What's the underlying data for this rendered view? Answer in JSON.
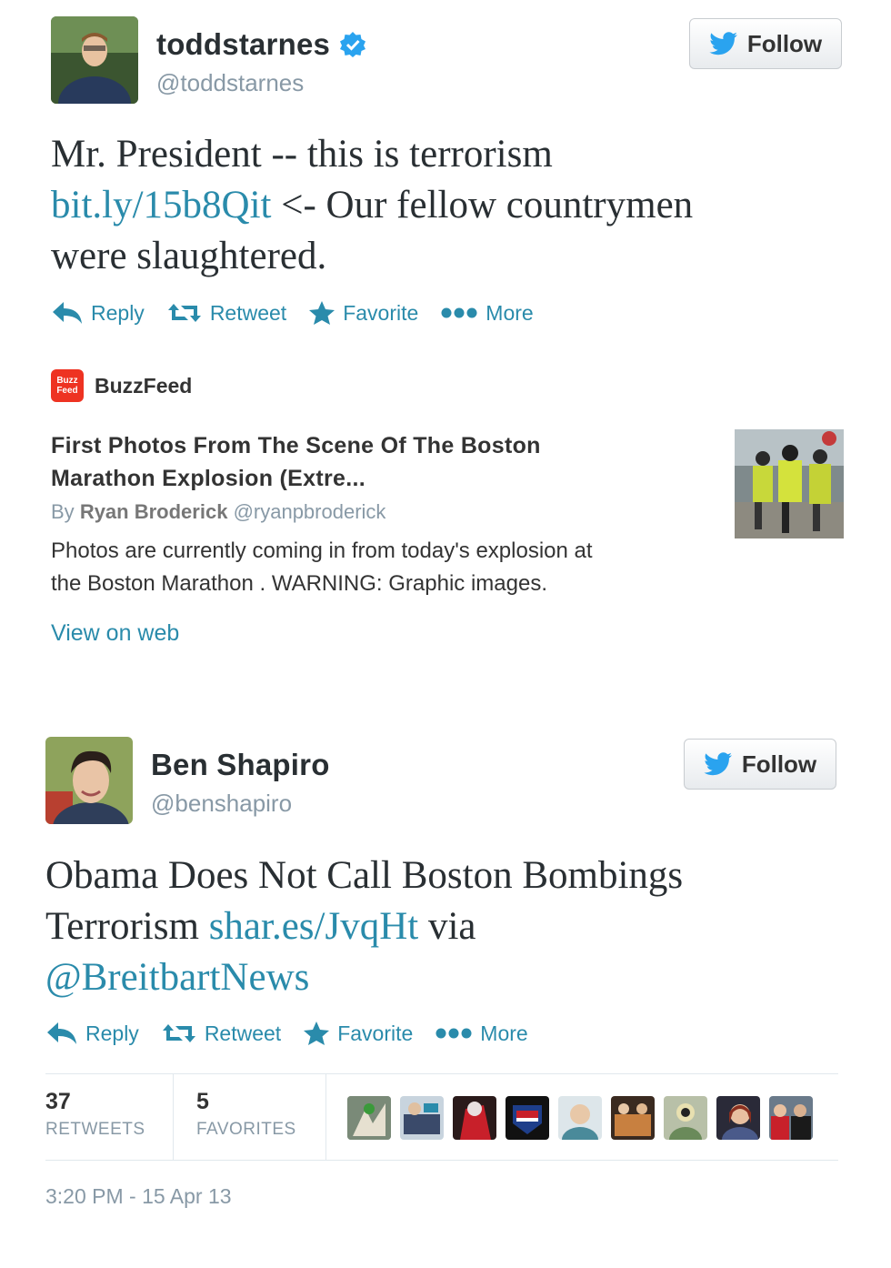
{
  "tweets": [
    {
      "name": "toddstarnes",
      "handle": "@toddstarnes",
      "verified": true,
      "follow_label": "Follow",
      "text_1": "Mr. President -- this is terrorism",
      "link": "bit.ly/15b8Qit",
      "text_2": " <- Our fellow countrymen",
      "text_3": "were slaughtered.",
      "actions": {
        "reply": "Reply",
        "retweet": "Retweet",
        "favorite": "Favorite",
        "more": "More"
      },
      "card": {
        "source": "BuzzFeed",
        "logo_text": "Buzz Feed",
        "title_1": "First Photos From The Scene Of The Boston",
        "title_2": "Marathon Explosion (Extre...",
        "by_prefix": "By",
        "author": "Ryan Broderick",
        "author_handle": "@ryanpbroderick",
        "desc_1": "Photos are currently coming in from today's explosion at",
        "desc_2": "the Boston Marathon . WARNING: Graphic images.",
        "view_on_web": "View on web"
      }
    },
    {
      "name": "Ben Shapiro",
      "handle": "@benshapiro",
      "follow_label": "Follow",
      "text_1": "Obama Does Not Call Boston Bombings",
      "text_2a": "Terrorism ",
      "link": "shar.es/JvqHt",
      "text_2b": " via",
      "mention": "@BreitbartNews",
      "actions": {
        "reply": "Reply",
        "retweet": "Retweet",
        "favorite": "Favorite",
        "more": "More"
      },
      "stats": {
        "retweets_count": "37",
        "retweets_label": "RETWEETS",
        "favorites_count": "5",
        "favorites_label": "FAVORITES"
      },
      "timestamp": "3:20 PM - 15 Apr 13"
    }
  ],
  "colors": {
    "link": "#2a8bab",
    "verified": "#2aa3ef",
    "twitter_bird": "#2aa3ef"
  }
}
